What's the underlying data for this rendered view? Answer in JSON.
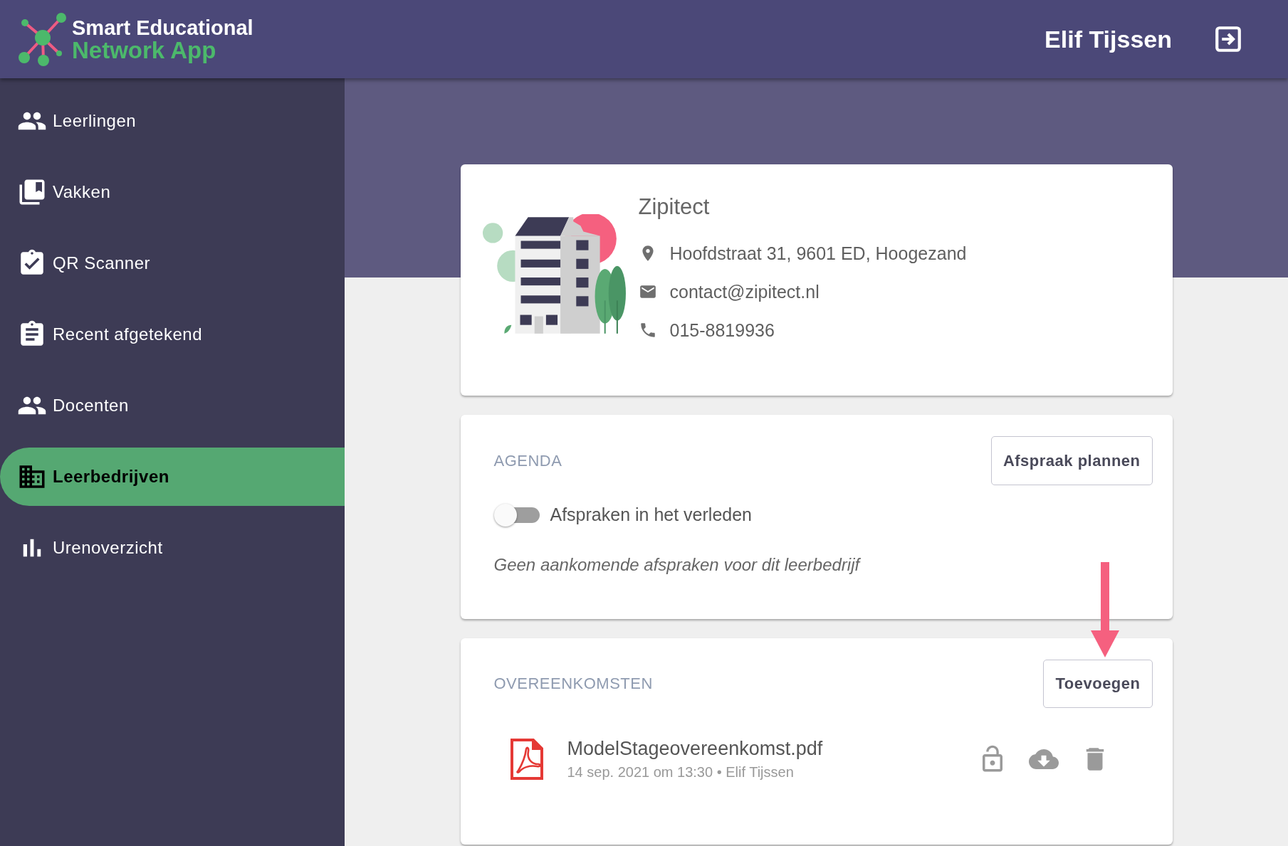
{
  "app": {
    "logo_line1": "Smart Educational",
    "logo_line2": "Network App"
  },
  "header": {
    "user_name": "Elif Tijssen"
  },
  "sidebar": {
    "items": [
      {
        "label": "Leerlingen",
        "kind": "people",
        "selected": false
      },
      {
        "label": "Vakken",
        "kind": "books",
        "selected": false
      },
      {
        "label": "QR Scanner",
        "kind": "scanner",
        "selected": false
      },
      {
        "label": "Recent afgetekend",
        "kind": "signed",
        "selected": false
      },
      {
        "label": "Docenten",
        "kind": "people",
        "selected": false
      },
      {
        "label": "Leerbedrijven",
        "kind": "companies",
        "selected": true
      },
      {
        "label": "Urenoverzicht",
        "kind": "hours",
        "selected": false
      }
    ]
  },
  "company": {
    "name": "Zipitect",
    "address": "Hoofdstraat 31, 9601 ED, Hoogezand",
    "email": "contact@zipitect.nl",
    "phone": "015-8819936"
  },
  "agenda": {
    "title": "AGENDA",
    "button": "Afspraak plannen",
    "toggle": {
      "label": "Afspraken in het verleden",
      "on": false
    },
    "empty_message": "Geen aankomende afspraken voor dit leerbedrijf"
  },
  "agreements": {
    "title": "OVEREENKOMSTEN",
    "button": "Toevoegen",
    "files": [
      {
        "name": "ModelStageovereenkomst.pdf",
        "meta": "14 sep. 2021 om 13:30 • Elif Tijssen",
        "locked": false
      }
    ]
  }
}
